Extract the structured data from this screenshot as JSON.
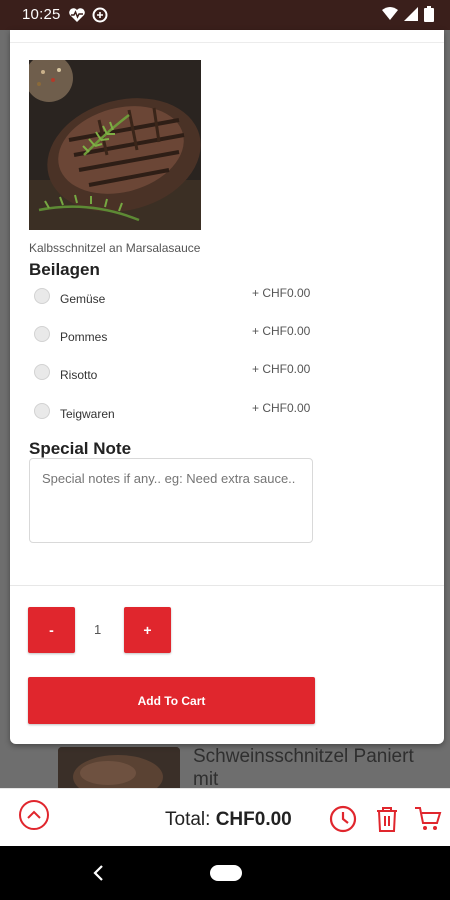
{
  "status_bar": {
    "time": "10:25"
  },
  "dish": {
    "name": "Kalbsschnitzel an Marsalasauce"
  },
  "beilagen": {
    "title": "Beilagen",
    "options": [
      {
        "label": "Gemüse",
        "price": "+ CHF0.00"
      },
      {
        "label": "Pommes",
        "price": "+ CHF0.00"
      },
      {
        "label": "Risotto",
        "price": "+ CHF0.00"
      },
      {
        "label": "Teigwaren",
        "price": "+ CHF0.00"
      }
    ]
  },
  "special_note": {
    "title": "Special Note",
    "placeholder": "Special notes if any.. eg: Need extra sauce.."
  },
  "quantity": {
    "minus_label": "-",
    "value": "1",
    "plus_label": "+"
  },
  "add_to_cart_label": "Add To Cart",
  "background_item": {
    "title": "Schweinsschnitzel Paniert mit"
  },
  "footer": {
    "total_label": "Total:",
    "total_value": "CHF0.00"
  },
  "colors": {
    "accent": "#e0262d",
    "status_bar": "#3a1f1b"
  }
}
